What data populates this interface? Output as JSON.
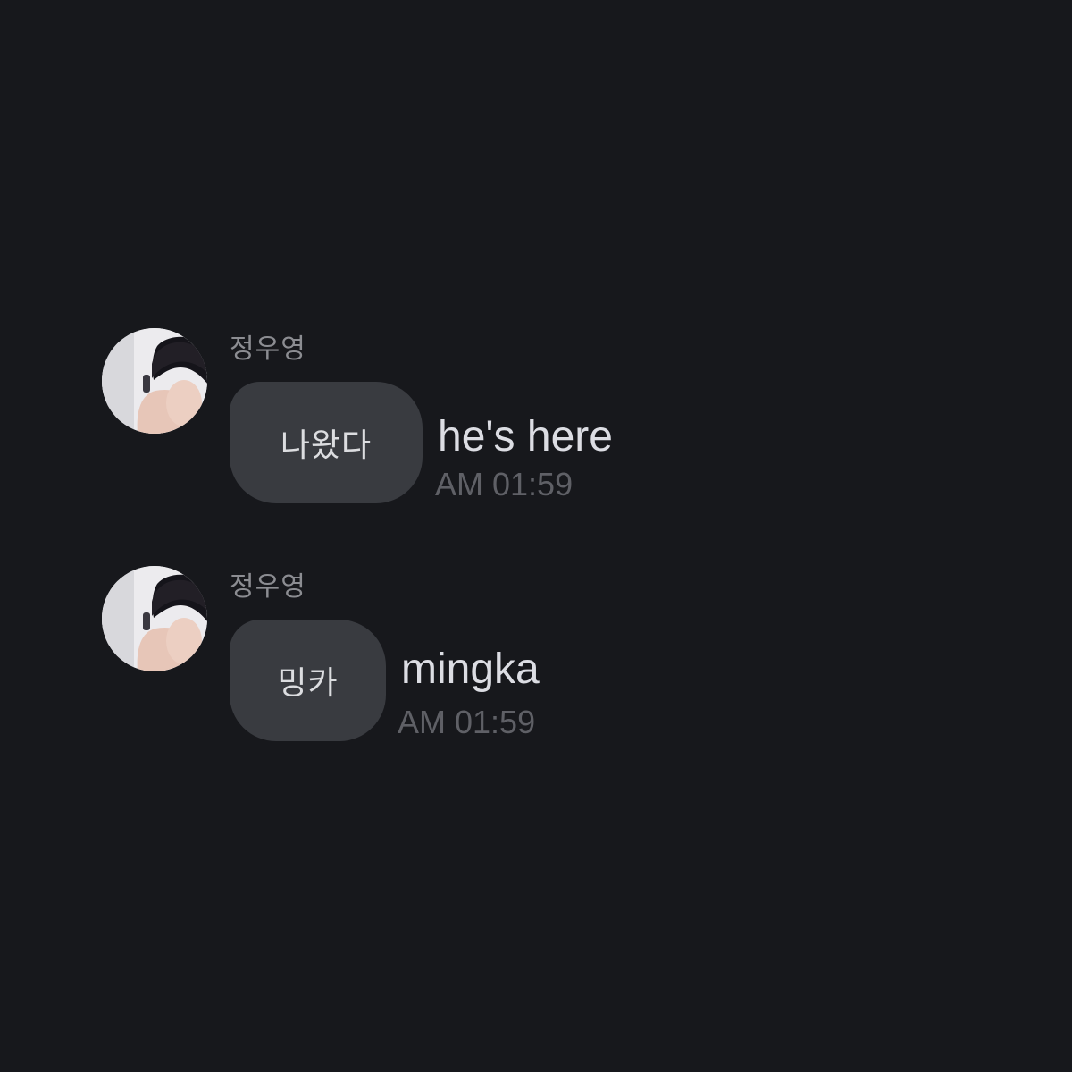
{
  "chat": {
    "messages": [
      {
        "sender": "정우영",
        "text": "나왔다",
        "translation": "he's here",
        "time": "AM 01:59"
      },
      {
        "sender": "정우영",
        "text": "밍카",
        "translation": "mingka",
        "time": "AM 01:59"
      }
    ]
  }
}
